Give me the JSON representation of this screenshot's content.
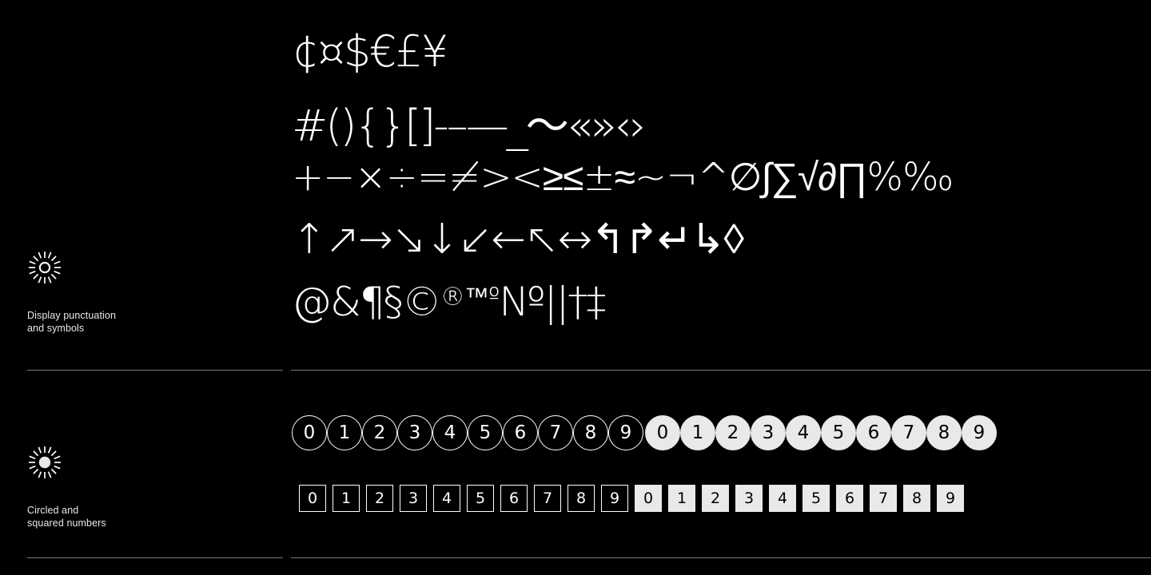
{
  "theme": {
    "background": "#000000",
    "foreground": "#ffffff",
    "muted_text": "#e9e9e9",
    "rule_color": "#7a7a7a",
    "chip_fill": "#e9e9e9",
    "chip_text_on_fill": "#000000"
  },
  "sections": [
    {
      "id": "display-punctuation",
      "icon": "sun-outline-icon",
      "label": "Display punctuation\nand symbols",
      "rows": [
        {
          "id": "currency",
          "name": "currency-symbols",
          "text": "¢¤$€£¥",
          "glyphs": [
            "¢",
            "¤",
            "$",
            "€",
            "£",
            "¥"
          ]
        },
        {
          "id": "brackets-dashes",
          "name": "brackets-and-dashes",
          "text": "#(){}[]-–—_～«»‹›",
          "glyphs": [
            "#",
            "(",
            ")",
            "{",
            "}",
            "[",
            "]",
            "-",
            "–",
            "—",
            "_",
            "～",
            "«",
            "»",
            "‹",
            "›"
          ]
        },
        {
          "id": "math-operators",
          "name": "math-operators",
          "text": "+−×÷=≠><≥≤±≈~¬^∅∫∑√∂∏%‰",
          "glyphs": [
            "+",
            "−",
            "×",
            "÷",
            "=",
            "≠",
            ">",
            "<",
            "≥",
            "≤",
            "±",
            "≈",
            "~",
            "¬",
            "^",
            "∅",
            "∫",
            "∑",
            "√",
            "∂",
            "∏",
            "%",
            "‰"
          ]
        },
        {
          "id": "arrows",
          "name": "arrow-glyphs",
          "text": "↑↗→↘↓↙←↖↔↰↱↵↳◊",
          "glyphs": [
            "↑",
            "↗",
            "→",
            "↘",
            "↓",
            "↙",
            "←",
            "↖",
            "↔",
            "↰",
            "↱",
            "↵",
            "↳",
            "◊"
          ]
        },
        {
          "id": "reference-marks",
          "name": "reference-marks",
          "text": "@&¶§©",
          "superscript_text": "®™º",
          "tail_text": "№||†‡",
          "glyphs": [
            "@",
            "&",
            "¶",
            "§",
            "©",
            "®",
            "™",
            "º",
            "№",
            "|",
            "‖",
            "†",
            "‡"
          ]
        }
      ]
    },
    {
      "id": "circled-squared-numbers",
      "icon": "sun-solid-icon",
      "label": "Circled and\nsquared numbers",
      "rows": [
        {
          "id": "circled-outline",
          "name": "circled-numbers-outline",
          "style": "outline",
          "shape": "circle",
          "values": [
            "0",
            "1",
            "2",
            "3",
            "4",
            "5",
            "6",
            "7",
            "8",
            "9"
          ]
        },
        {
          "id": "circled-solid",
          "name": "circled-numbers-solid",
          "style": "solid",
          "shape": "circle",
          "values": [
            "0",
            "1",
            "2",
            "3",
            "4",
            "5",
            "6",
            "7",
            "8",
            "9"
          ]
        },
        {
          "id": "squared-outline",
          "name": "squared-numbers-outline",
          "style": "outline",
          "shape": "square",
          "values": [
            "0",
            "1",
            "2",
            "3",
            "4",
            "5",
            "6",
            "7",
            "8",
            "9"
          ]
        },
        {
          "id": "squared-solid",
          "name": "squared-numbers-solid",
          "style": "solid",
          "shape": "square",
          "values": [
            "0",
            "1",
            "2",
            "3",
            "4",
            "5",
            "6",
            "7",
            "8",
            "9"
          ]
        }
      ]
    }
  ]
}
